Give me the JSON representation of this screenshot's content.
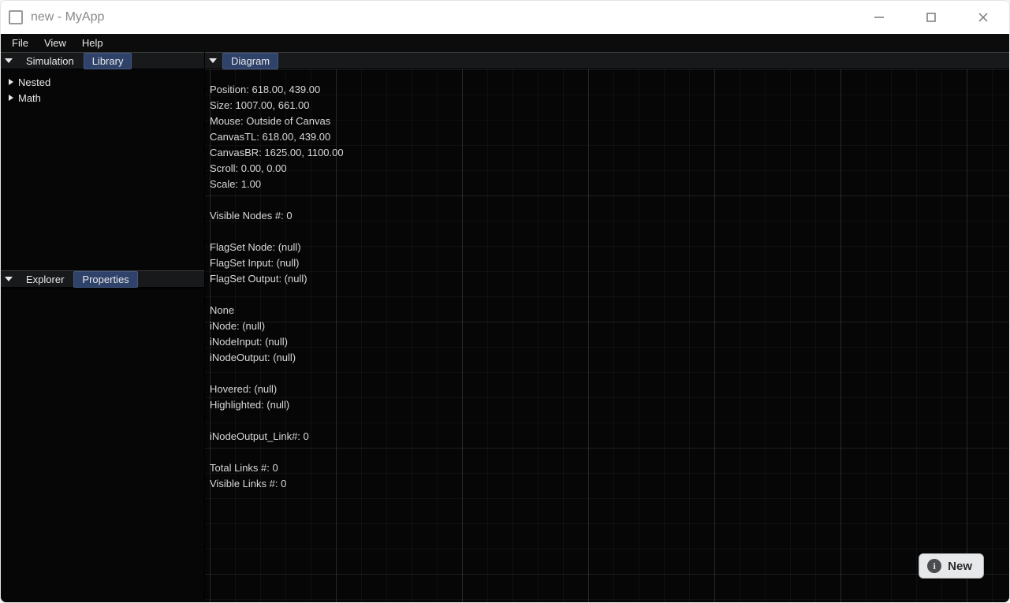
{
  "window": {
    "title": "new - MyApp"
  },
  "menubar": {
    "items": [
      "File",
      "View",
      "Help"
    ]
  },
  "left": {
    "top_tabs": {
      "items": [
        "Simulation",
        "Library"
      ],
      "active": "Library"
    },
    "tree": {
      "items": [
        "Nested",
        "Math"
      ]
    },
    "bottom_tabs": {
      "items": [
        "Explorer",
        "Properties"
      ],
      "active": "Properties"
    }
  },
  "right": {
    "tabs": {
      "items": [
        "Diagram"
      ],
      "active": "Diagram"
    },
    "debug_lines": [
      "Position: 618.00, 439.00",
      "Size: 1007.00, 661.00",
      "Mouse: Outside of Canvas",
      "CanvasTL: 618.00, 439.00",
      "CanvasBR: 1625.00, 1100.00",
      "Scroll: 0.00, 0.00",
      "Scale: 1.00",
      "",
      "Visible Nodes #: 0",
      "",
      "FlagSet Node: (null)",
      "FlagSet Input: (null)",
      "FlagSet Output: (null)",
      "",
      "None",
      "iNode: (null)",
      "iNodeInput: (null)",
      "iNodeOutput: (null)",
      "",
      "Hovered: (null)",
      "Highlighted: (null)",
      "",
      "iNodeOutput_Link#: 0",
      "",
      "Total Links #: 0",
      "Visible Links #: 0"
    ]
  },
  "toast": {
    "label": "New"
  }
}
